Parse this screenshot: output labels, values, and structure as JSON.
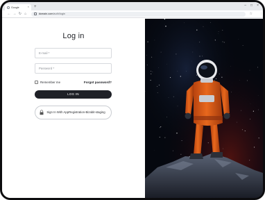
{
  "browser": {
    "tab_title": "Google",
    "tab_close": "×",
    "new_tab": "+",
    "url_host": "domain.com",
    "url_path": "/auth/login",
    "nav": {
      "back": "←",
      "forward": "→",
      "reload": "↻",
      "home": "⌂"
    },
    "bookmark": "☆",
    "menu": "⋮",
    "window_controls": {
      "minimize": "–",
      "maximize": "□",
      "close": "×"
    }
  },
  "login": {
    "title": "Log in",
    "email_placeholder": "E-mail *",
    "password_placeholder": "Password *",
    "remember_me": "Remember me",
    "forgot_password": "Forgot password?",
    "login_button": "LOG IN",
    "sso_button": "Sign In With AppRegistration-Bizabit-staging"
  },
  "hero": {
    "icon": "astronaut-on-rock-image",
    "colors": {
      "suit": "#e2621b",
      "sky": "#05080f",
      "rock": "#3a4252"
    }
  }
}
